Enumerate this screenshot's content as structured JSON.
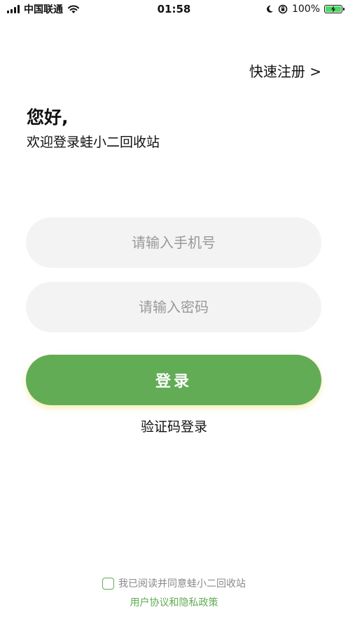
{
  "status_bar": {
    "carrier": "中国联通",
    "time": "01:58",
    "battery": "100%",
    "battery_level": 1.0,
    "icons": [
      "signal-icon",
      "wifi-icon",
      "moon-icon",
      "rotation-lock-icon",
      "battery-icon"
    ]
  },
  "header": {
    "quick_register": "快速注册 >"
  },
  "greeting": {
    "title": "您好,",
    "subtitle": "欢迎登录蛙小二回收站"
  },
  "form": {
    "phone_placeholder": "请输入手机号",
    "password_placeholder": "请输入密码",
    "login_label": "登录",
    "code_login": "验证码登录"
  },
  "agreement": {
    "text": "我已阅读并同意蛙小二回收站",
    "link": "用户协议和隐私政策"
  },
  "colors": {
    "accent": "#62ac55",
    "input_bg": "#f3f3f3",
    "placeholder": "#999999",
    "muted_text": "#8a8a8a"
  }
}
